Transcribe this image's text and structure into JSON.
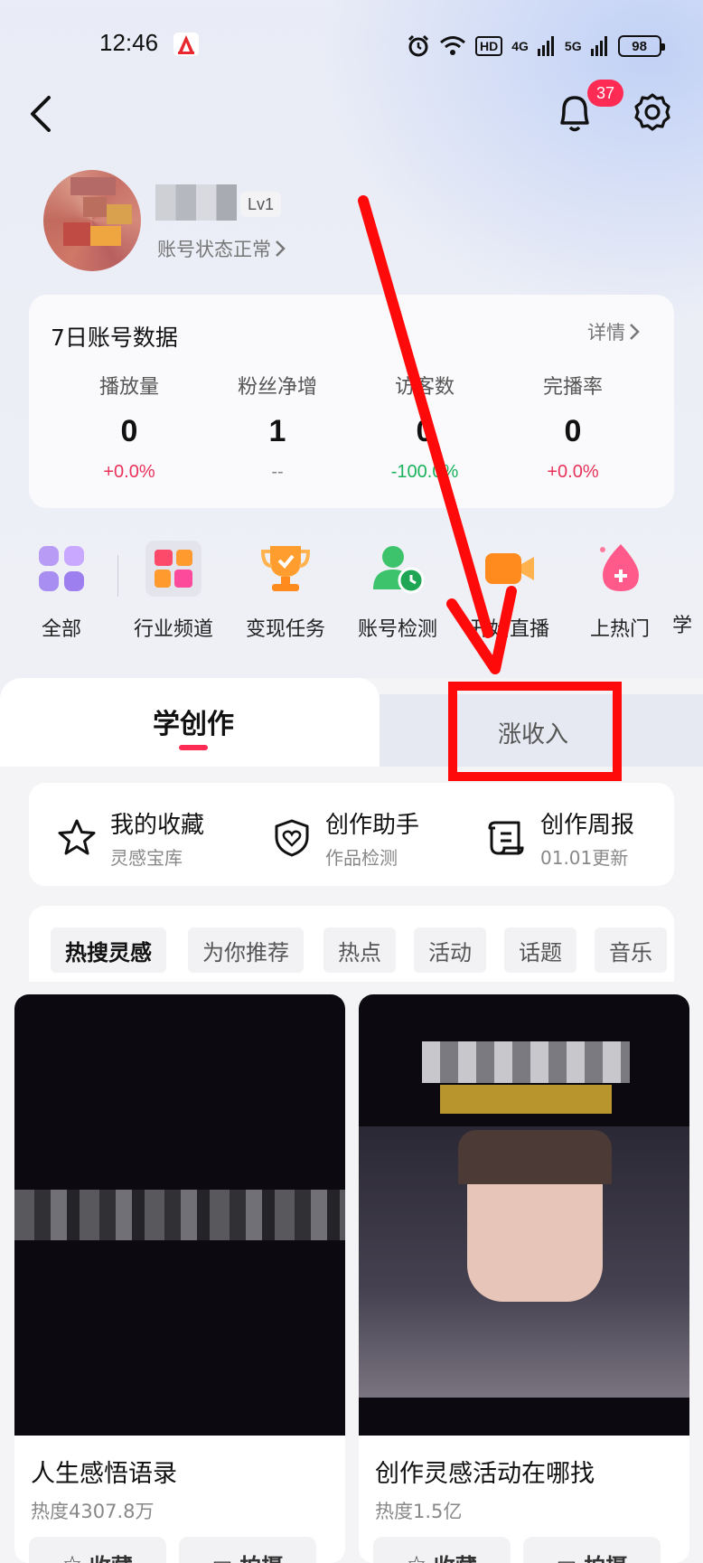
{
  "status_bar": {
    "time": "12:46",
    "hd_label": "HD",
    "net1": "4G",
    "net2": "5G",
    "battery": "98"
  },
  "header": {
    "notification_count": "37"
  },
  "profile": {
    "level": "Lv1",
    "account_status": "账号状态正常"
  },
  "data_card": {
    "title": "7日账号数据",
    "detail_label": "详情",
    "stats": [
      {
        "label": "播放量",
        "value": "0",
        "change": "+0.0%"
      },
      {
        "label": "粉丝净增",
        "value": "1",
        "change": "--"
      },
      {
        "label": "访客数",
        "value": "0",
        "change": "-100.0%"
      },
      {
        "label": "完播率",
        "value": "0",
        "change": "+0.0%"
      }
    ]
  },
  "tools": [
    {
      "label": "全部",
      "icon": "grid-icon"
    },
    {
      "label": "行业频道",
      "icon": "industry-channel-icon"
    },
    {
      "label": "变现任务",
      "icon": "trophy-icon"
    },
    {
      "label": "账号检测",
      "icon": "account-check-icon"
    },
    {
      "label": "开始直播",
      "icon": "video-camera-icon"
    },
    {
      "label": "上热门",
      "icon": "flame-plus-icon"
    },
    {
      "label": "学",
      "icon": "partial-icon"
    }
  ],
  "tabs": {
    "learn": "学创作",
    "earn": "涨收入"
  },
  "shortcuts": [
    {
      "title": "我的收藏",
      "sub": "灵感宝库",
      "icon": "star-icon"
    },
    {
      "title": "创作助手",
      "sub": "作品检测",
      "icon": "shield-heart-icon"
    },
    {
      "title": "创作周报",
      "sub": "01.01更新",
      "icon": "report-icon"
    }
  ],
  "chips": [
    "热搜灵感",
    "为你推荐",
    "热点",
    "活动",
    "话题",
    "音乐"
  ],
  "videos": [
    {
      "title": "人生感悟语录",
      "heat": "热度4307.8万",
      "btn1": "收藏",
      "btn2": "拍摄"
    },
    {
      "title": "创作灵感活动在哪找",
      "heat": "热度1.5亿",
      "btn1": "收藏",
      "btn2": "拍摄"
    }
  ],
  "colors": {
    "accent": "#fe2c55",
    "positive": "#e8325a",
    "negative": "#19b25a",
    "annotation": "#ff0a0a"
  }
}
